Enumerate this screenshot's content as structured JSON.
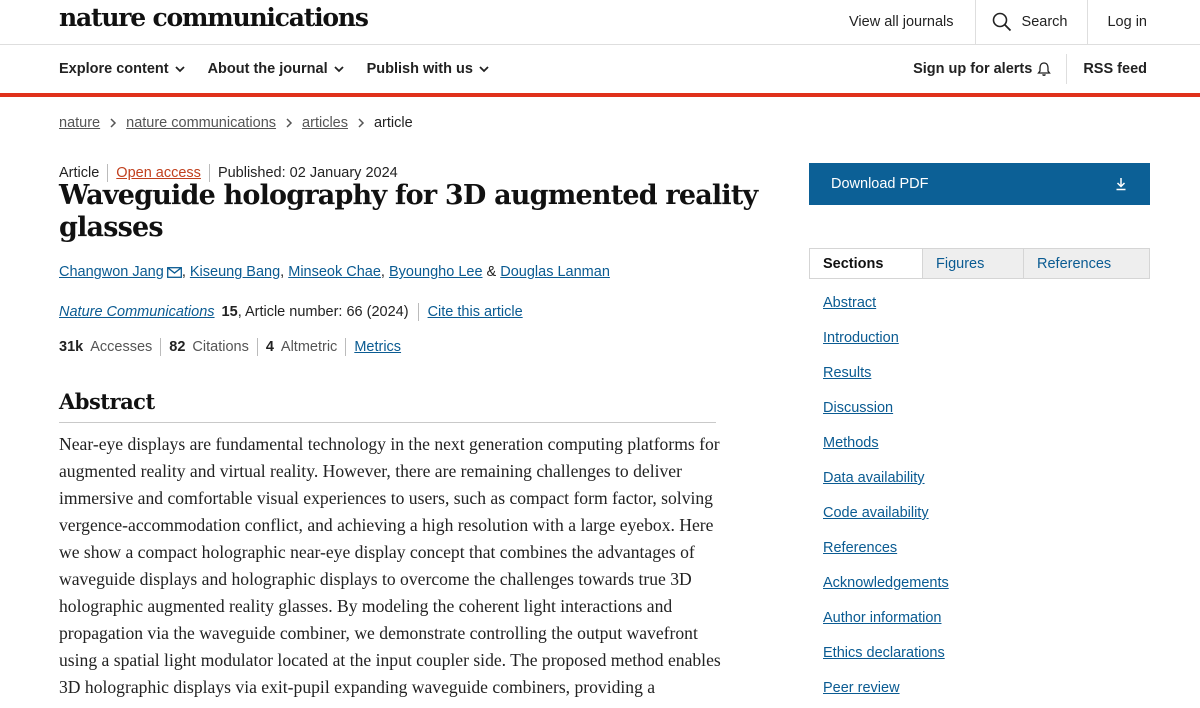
{
  "header": {
    "logo": "nature communications",
    "links": {
      "view_all": "View all journals",
      "search": "Search",
      "login": "Log in"
    }
  },
  "nav": {
    "items": [
      "Explore content",
      "About the journal",
      "Publish with us"
    ],
    "alerts": "Sign up for alerts",
    "rss": "RSS feed"
  },
  "breadcrumb": [
    "nature",
    "nature communications",
    "articles",
    "article"
  ],
  "article": {
    "type": "Article",
    "access": "Open access",
    "published": "Published: 02 January 2024",
    "title": "Waveguide holography for 3D augmented reality glasses",
    "authors": [
      "Changwon Jang",
      "Kiseung Bang",
      "Minseok Chae",
      "Byoungho Lee",
      "Douglas Lanman"
    ],
    "author_sep": ", ",
    "author_and": " & ",
    "journal": "Nature Communications",
    "volume": "15",
    "article_number": ", Article number: 66 (2024)",
    "cite": "Cite this article",
    "metrics": {
      "accesses_value": "31k",
      "accesses_label": "Accesses",
      "citations_value": "82",
      "citations_label": "Citations",
      "altmetric_value": "4",
      "altmetric_label": "Altmetric",
      "link": "Metrics"
    }
  },
  "abstract": {
    "heading": "Abstract",
    "text": "Near-eye displays are fundamental technology in the next generation computing platforms for augmented reality and virtual reality. However, there are remaining challenges to deliver immersive and comfortable visual experiences to users, such as compact form factor, solving vergence-accommodation conflict, and achieving a high resolution with a large eyebox. Here we show a compact holographic near-eye display concept that combines the advantages of waveguide displays and holographic displays to overcome the challenges towards true 3D holographic augmented reality glasses. By modeling the coherent light interactions and propagation via the waveguide combiner, we demonstrate controlling the output wavefront using a spatial light modulator located at the input coupler side. The proposed method enables 3D holographic displays via exit-pupil expanding waveguide combiners, providing a"
  },
  "sidebar": {
    "download": "Download PDF",
    "tabs": [
      "Sections",
      "Figures",
      "References"
    ],
    "sections": [
      "Abstract",
      "Introduction",
      "Results",
      "Discussion",
      "Methods",
      "Data availability",
      "Code availability",
      "References",
      "Acknowledgements",
      "Author information",
      "Ethics declarations",
      "Peer review"
    ]
  },
  "colors": {
    "accent_red": "#e0311b",
    "link_blue": "#0a5b92",
    "download_blue": "#0c6096",
    "open_access": "#c1401e"
  }
}
